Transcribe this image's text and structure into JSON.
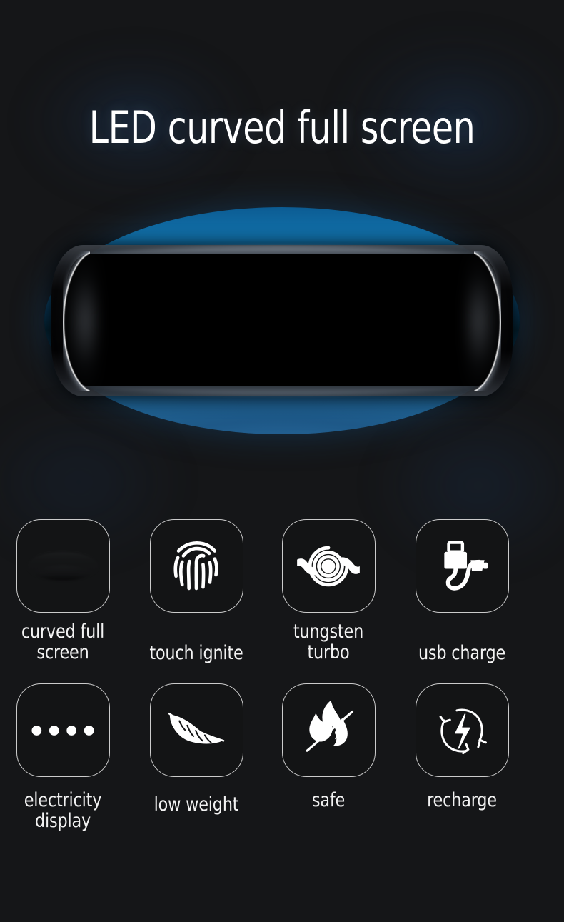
{
  "headline": "LED curved full screen",
  "colors": {
    "background": "#151618",
    "accent_blue": "#1273ad",
    "accent_blue_dark": "#04202f",
    "screen_black": "#000000",
    "text": "#f2f2f2",
    "icon_border": "rgba(255,255,255,0.78)"
  },
  "hero": {
    "name": "led-curved-lighter-product",
    "body_shape": "blue-ellipse",
    "screen_shape": "black-curved-display",
    "highlights": [
      "left-edge-crescent",
      "right-edge-crescent"
    ]
  },
  "features": {
    "rows": [
      {
        "items": [
          {
            "icon": "curved-screen-icon",
            "label": "curved full\nscreen"
          },
          {
            "icon": "fingerprint-icon",
            "label": "touch ignite"
          },
          {
            "icon": "coil-spiral-icon",
            "label": "tungsten\nturbo"
          },
          {
            "icon": "usb-cable-icon",
            "label": "usb charge"
          }
        ]
      },
      {
        "items": [
          {
            "icon": "battery-dots-icon",
            "label": "electricity\ndisplay"
          },
          {
            "icon": "feather-icon",
            "label": "low weight"
          },
          {
            "icon": "flame-no-fire-icon",
            "label": "safe"
          },
          {
            "icon": "recharge-loop-icon",
            "label": "recharge"
          }
        ]
      }
    ]
  }
}
